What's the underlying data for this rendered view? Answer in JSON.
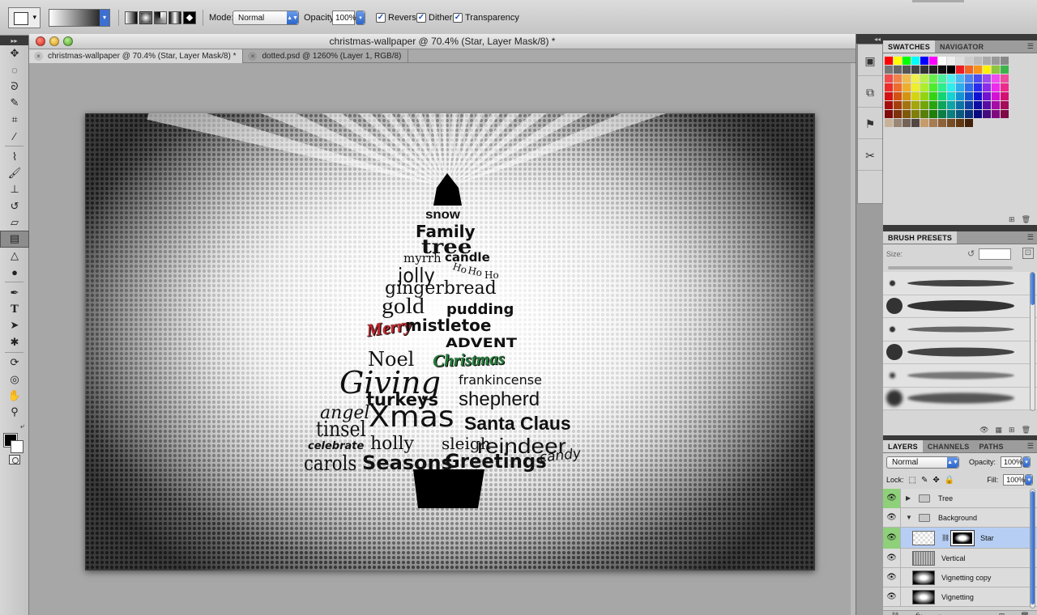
{
  "options_bar": {
    "mode_label": "Mode:",
    "mode_value": "Normal",
    "opacity_label": "Opacity:",
    "opacity_value": "100%",
    "reverse_label": "Reverse",
    "dither_label": "Dither",
    "transparency_label": "Transparency",
    "checkbox_mark": "✓"
  },
  "document": {
    "window_title": "christmas-wallpaper @ 70.4% (Star, Layer Mask/8) *",
    "tabs": [
      {
        "label": "christmas-wallpaper @ 70.4% (Star, Layer Mask/8) *",
        "active": true
      },
      {
        "label": "dotted.psd @ 1260% (Layer 1, RGB/8)",
        "active": false
      }
    ],
    "tab_close_glyph": "×"
  },
  "artwork": {
    "words": [
      {
        "text": "snow",
        "color": "#111111"
      },
      {
        "text": "Family",
        "color": "#111111"
      },
      {
        "text": "tree",
        "color": "#111111"
      },
      {
        "text": "myrrh",
        "color": "#111111"
      },
      {
        "text": "candle",
        "color": "#111111"
      },
      {
        "text": "Ho",
        "color": "#111111"
      },
      {
        "text": "Ho",
        "color": "#111111"
      },
      {
        "text": "Ho",
        "color": "#111111"
      },
      {
        "text": "jolly",
        "color": "#111111"
      },
      {
        "text": "gingerbread",
        "color": "#111111"
      },
      {
        "text": "gold",
        "color": "#111111"
      },
      {
        "text": "pudding",
        "color": "#111111"
      },
      {
        "text": "Merry",
        "color": "#c0262c"
      },
      {
        "text": "mistletoe",
        "color": "#111111"
      },
      {
        "text": "ADVENT",
        "color": "#111111"
      },
      {
        "text": "Noel",
        "color": "#111111"
      },
      {
        "text": "Christmas",
        "color": "#1f7a35"
      },
      {
        "text": "Giving",
        "color": "#111111"
      },
      {
        "text": "frankincense",
        "color": "#111111"
      },
      {
        "text": "turkeys",
        "color": "#111111"
      },
      {
        "text": "shepherd",
        "color": "#111111"
      },
      {
        "text": "angel",
        "color": "#111111"
      },
      {
        "text": "Xmas",
        "color": "#111111"
      },
      {
        "text": "tinsel",
        "color": "#111111"
      },
      {
        "text": "Santa Claus",
        "color": "#111111"
      },
      {
        "text": "celebrate",
        "color": "#111111"
      },
      {
        "text": "holly",
        "color": "#111111"
      },
      {
        "text": "sleigh",
        "color": "#111111"
      },
      {
        "text": "reindeer",
        "color": "#111111"
      },
      {
        "text": "carols",
        "color": "#111111"
      },
      {
        "text": "Seasons",
        "color": "#111111"
      },
      {
        "text": "Greetings",
        "color": "#111111"
      },
      {
        "text": "candy",
        "color": "#111111"
      }
    ]
  },
  "panels": {
    "swatches_tab": "SWATCHES",
    "navigator_tab": "NAVIGATOR",
    "brush_presets_tab": "BRUSH PRESETS",
    "brush_size_label": "Size:",
    "layers_tab": "LAYERS",
    "channels_tab": "CHANNELS",
    "paths_tab": "PATHS",
    "blend_mode": "Normal",
    "opacity_label": "Opacity:",
    "opacity_value": "100%",
    "lock_label": "Lock:",
    "fill_label": "Fill:",
    "fill_value": "100%",
    "layers": [
      {
        "name": "Tree",
        "kind": "group",
        "expanded": false,
        "visible": true,
        "selected": false
      },
      {
        "name": "Background",
        "kind": "group",
        "expanded": true,
        "visible": true,
        "selected": false
      },
      {
        "name": "Star",
        "kind": "layer-mask",
        "visible": true,
        "selected": true
      },
      {
        "name": "Vertical",
        "kind": "layer",
        "visible": true,
        "selected": false
      },
      {
        "name": "Vignetting copy",
        "kind": "layer",
        "visible": true,
        "selected": false
      },
      {
        "name": "Vignetting",
        "kind": "layer",
        "visible": true,
        "selected": false
      }
    ]
  }
}
